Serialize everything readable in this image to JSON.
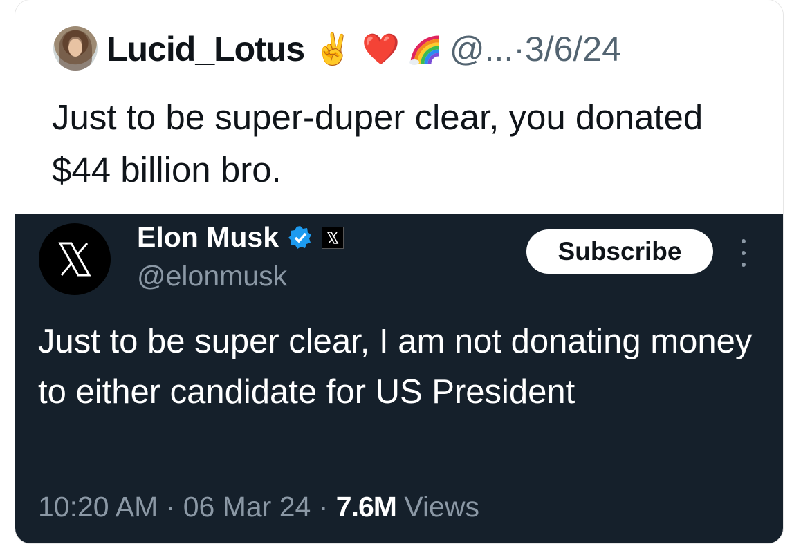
{
  "reply": {
    "display_name": "Lucid_Lotus",
    "emojis": [
      "✌️",
      "❤️"
    ],
    "handle_date": "@...·3/6/24",
    "text": "Just to be super-duper clear, you donated $44 billion bro."
  },
  "quoted_tweet": {
    "name": "Elon Musk",
    "handle": "@elonmusk",
    "subscribe_label": "Subscribe",
    "text": "Just to be super clear, I am not donating money to either candidate for US President",
    "time": "10:20 AM",
    "date": "06 Mar 24",
    "views_count": "7.6M",
    "views_label": "Views",
    "separator": "·"
  },
  "colors": {
    "dark_bg": "#15202b",
    "verified": "#1d9bf0",
    "muted": "#8b98a5"
  },
  "icons": [
    "avatar",
    "peace-hand-emoji",
    "heart-emoji",
    "rainbow-icon",
    "x-logo-icon",
    "verified-badge-icon",
    "x-badge-icon",
    "more-icon"
  ]
}
